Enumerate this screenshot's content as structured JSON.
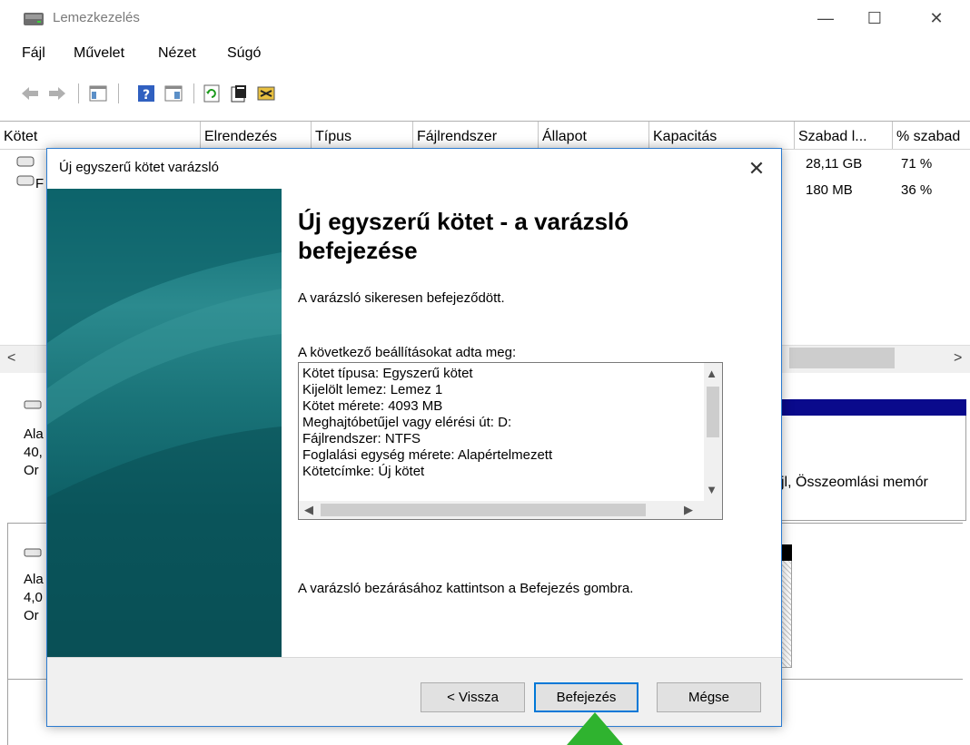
{
  "window": {
    "title": "Lemezkezelés",
    "controls": {
      "minimize": "—",
      "maximize": "☐",
      "close": "✕"
    }
  },
  "menu": [
    "Fájl",
    "Művelet",
    "Nézet",
    "Súgó"
  ],
  "toolbar": {
    "icons": [
      "back-icon",
      "forward-icon",
      "console-tree-icon",
      "help-icon",
      "list-view-icon",
      "refresh-icon",
      "properties-icon",
      "disk-settings-icon"
    ]
  },
  "volume_list": {
    "columns": [
      "Kötet",
      "Elrendezés",
      "Típus",
      "Fájlrendszer",
      "Állapot",
      "Kapacitás",
      "Szabad l...",
      "% szabad"
    ],
    "rows": [
      {
        "name": "",
        "free": "28,11 GB",
        "pct": "71 %"
      },
      {
        "name": "F",
        "free": "180 MB",
        "pct": "36 %"
      }
    ]
  },
  "disk_view": {
    "disk0": {
      "label1": "Ala",
      "label2": "40,",
      "label3": "Or",
      "part_text": "jl, Összeomlási memór"
    },
    "disk1": {
      "label1": "Ala",
      "label2": "4,0",
      "label3": "Or"
    }
  },
  "dialog": {
    "title": "Új egyszerű kötet varázsló",
    "heading": "Új egyszerű kötet - a varázsló befejezése",
    "success_text": "A varázsló sikeresen befejeződött.",
    "settings_label": "A következő beállításokat adta meg:",
    "settings": [
      "Kötet típusa: Egyszerű kötet",
      "Kijelölt lemez: Lemez 1",
      "Kötet mérete: 4093 MB",
      "Meghajtóbetűjel vagy elérési út: D:",
      "Fájlrendszer: NTFS",
      "Foglalási egység mérete: Alapértelmezett",
      "Kötetcímke: Új kötet"
    ],
    "finish_text": "A varázsló bezárásához kattintson a Befejezés gombra.",
    "buttons": {
      "back": "< Vissza",
      "finish": "Befejezés",
      "cancel": "Mégse"
    }
  },
  "colors": {
    "accent": "#0078d7",
    "highlight_arrow": "#2fb32f",
    "wizard_side": "#0e6a72"
  }
}
